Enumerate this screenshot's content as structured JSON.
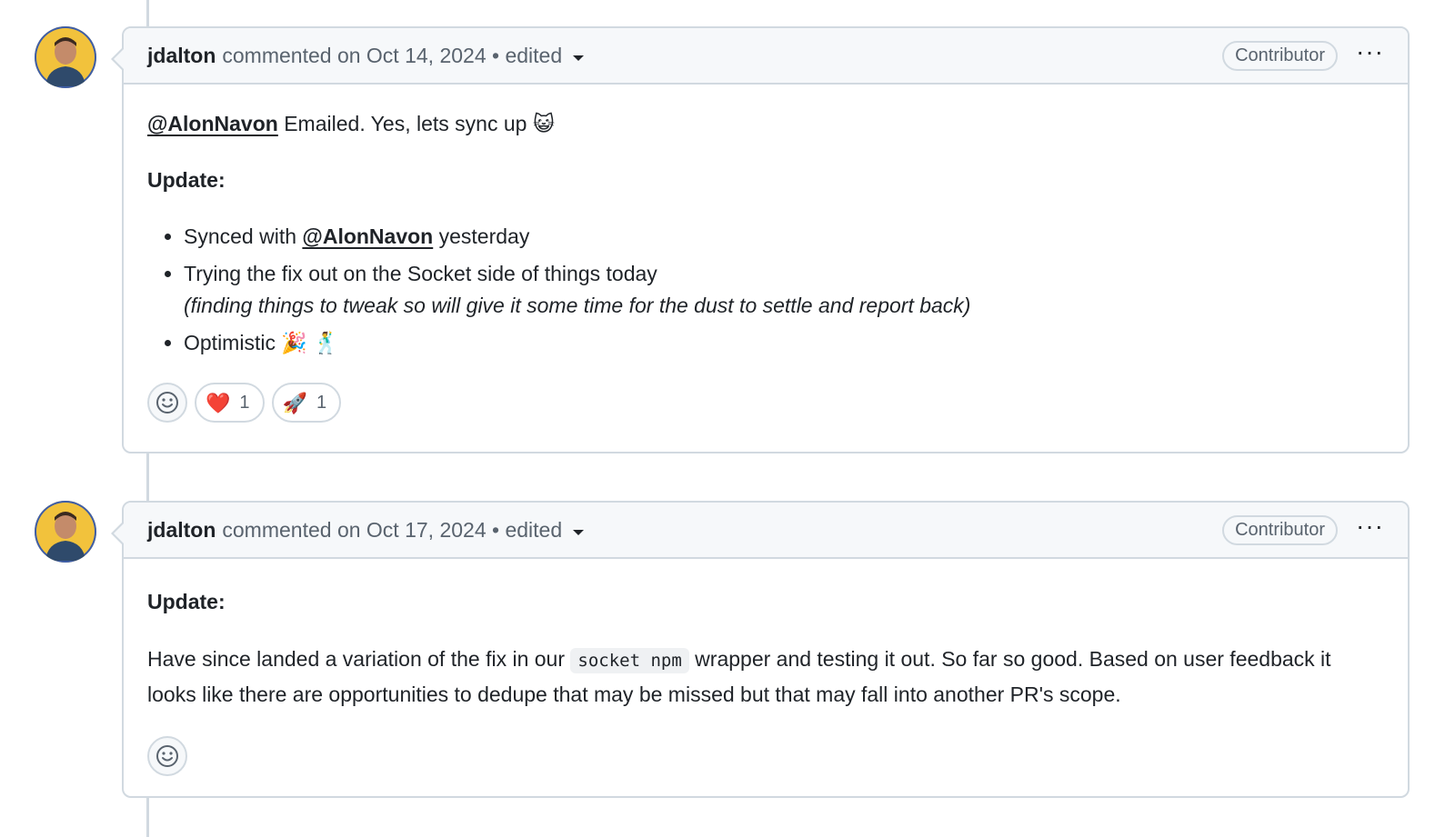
{
  "comments": [
    {
      "author": "jdalton",
      "meta": "commented on Oct 14, 2024 • edited",
      "badge": "Contributor",
      "body": {
        "line1_mention": "@AlonNavon",
        "line1_text": " Emailed. Yes, lets sync up ",
        "line1_emoji": "😺",
        "update_heading": "Update:",
        "bullets": {
          "b1_pre": "Synced with ",
          "b1_mention": "@AlonNavon",
          "b1_post": " yesterday",
          "b2_text": "Trying the fix out on the Socket side of things today",
          "b2_italic": "(finding things to tweak so will give it some time for the dust to settle and report back)",
          "b3_text": "Optimistic ",
          "b3_emoji": "🎉 🕺"
        }
      },
      "reactions": [
        {
          "emoji": "❤️",
          "count": "1"
        },
        {
          "emoji": "🚀",
          "count": "1"
        }
      ]
    },
    {
      "author": "jdalton",
      "meta": "commented on Oct 17, 2024 • edited",
      "badge": "Contributor",
      "body": {
        "update_heading": "Update:",
        "para_pre": "Have since landed a variation of the fix in our ",
        "para_code": "socket npm",
        "para_post": " wrapper and testing it out. So far so good. Based on user feedback it looks like there are opportunities to dedupe that may be missed but that may fall into another PR's scope."
      }
    }
  ],
  "icons": {
    "more": "kebab-horizontal-icon",
    "caret": "triangle-down-icon",
    "add_reaction": "smiley-icon"
  },
  "colors": {
    "border": "#d1d9e0",
    "header_bg": "#f6f8fa",
    "muted_text": "#59636e",
    "avatar_bg": "#f2c23c"
  }
}
